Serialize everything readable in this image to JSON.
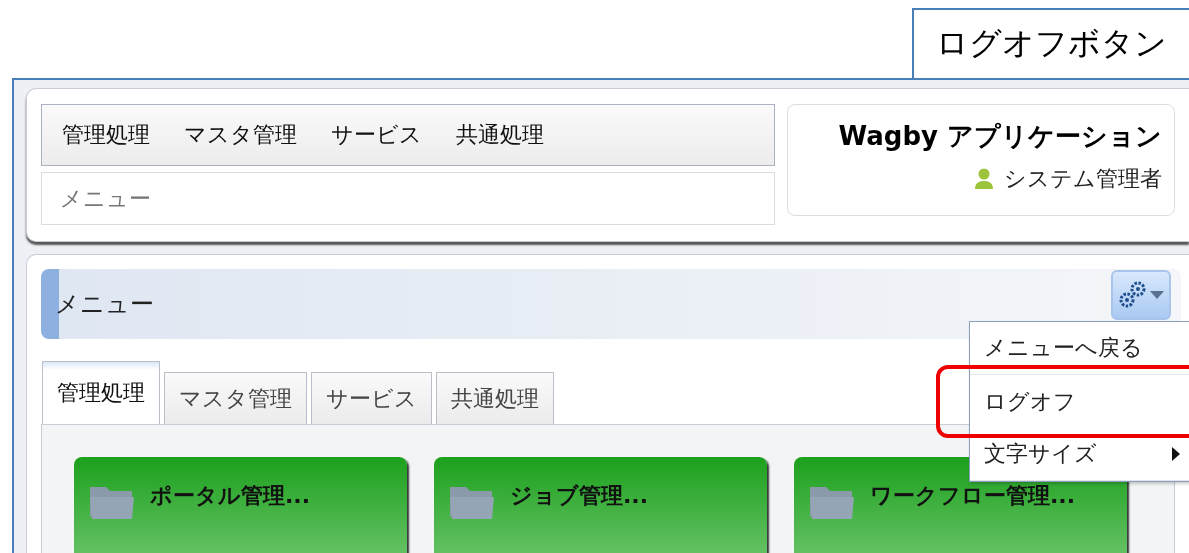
{
  "callout": {
    "label": "ログオフボタン"
  },
  "header": {
    "nav": [
      "管理処理",
      "マスタ管理",
      "サービス",
      "共通処理"
    ],
    "breadcrumb": "メニュー",
    "app_title": "Wagby アプリケーション",
    "user": "システム管理者"
  },
  "panel": {
    "title": "メニュー",
    "tabs": [
      {
        "label": "管理処理",
        "selected": true
      },
      {
        "label": "マスタ管理",
        "selected": false
      },
      {
        "label": "サービス",
        "selected": false
      },
      {
        "label": "共通処理",
        "selected": false
      }
    ],
    "cards": [
      {
        "label": "ポータル管理..."
      },
      {
        "label": "ジョブ管理..."
      },
      {
        "label": "ワークフロー管理..."
      }
    ]
  },
  "dropdown": {
    "items": [
      {
        "label": "メニューへ戻る",
        "highlighted": false,
        "has_submenu": false
      },
      {
        "label": "ログオフ",
        "highlighted": true,
        "has_submenu": false
      },
      {
        "label": "文字サイズ",
        "highlighted": false,
        "has_submenu": true
      }
    ]
  }
}
